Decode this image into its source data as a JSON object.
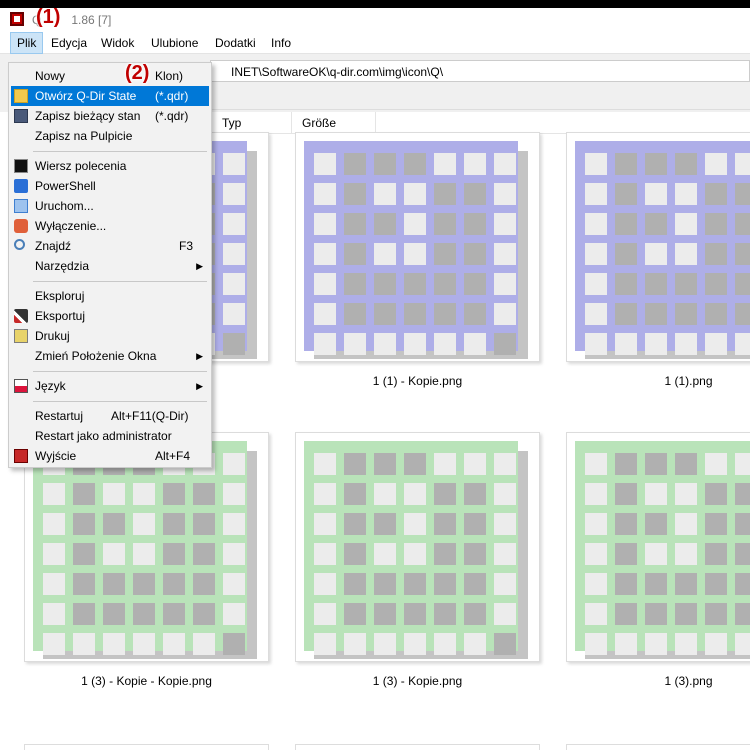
{
  "window": {
    "title_prefix": "Q",
    "title_rest": "1.86 [7]",
    "callout_1": "(1)",
    "callout_2": "(2)"
  },
  "menubar": {
    "items": [
      {
        "label": "Plik"
      },
      {
        "label": "Edycja"
      },
      {
        "label": "Widok"
      },
      {
        "label": "Ulubione"
      },
      {
        "label": "Dodatki"
      },
      {
        "label": "Info"
      }
    ]
  },
  "address": {
    "path": "INET\\SoftwareOK\\q-dir.com\\img\\icon\\Q\\"
  },
  "columns": {
    "typ": "Typ",
    "grosse": "Größe"
  },
  "file_menu": {
    "items": [
      {
        "label": "Nowy",
        "shortcut": "Klon)",
        "icon": "none"
      },
      {
        "label": "Otwórz Q-Dir State",
        "shortcut": "(*.qdr)",
        "icon": "folder-icon"
      },
      {
        "label": "Zapisz bieżący stan",
        "shortcut": "(*.qdr)",
        "icon": "save-icon"
      },
      {
        "label": "Zapisz na Pulpicie",
        "shortcut": "",
        "icon": "none"
      },
      {
        "label": "Wiersz polecenia",
        "shortcut": "",
        "icon": "cmd-icon"
      },
      {
        "label": "PowerShell",
        "shortcut": "",
        "icon": "powershell-icon"
      },
      {
        "label": "Uruchom...",
        "shortcut": "",
        "icon": "run-icon"
      },
      {
        "label": "Wyłączenie...",
        "shortcut": "",
        "icon": "shutdown-icon"
      },
      {
        "label": "Znajdź",
        "shortcut": "F3",
        "icon": "search-icon"
      },
      {
        "label": "Narzędzia",
        "shortcut": "",
        "icon": "none"
      },
      {
        "label": "Eksploruj",
        "shortcut": "",
        "icon": "none"
      },
      {
        "label": "Eksportuj",
        "shortcut": "",
        "icon": "export-icon"
      },
      {
        "label": "Drukuj",
        "shortcut": "",
        "icon": "print-icon"
      },
      {
        "label": "Zmień Położenie Okna",
        "shortcut": "",
        "icon": "none"
      },
      {
        "label": "Język",
        "shortcut": "",
        "icon": "language-icon"
      },
      {
        "label": "Restartuj",
        "shortcut": "Alt+F11(Q-Dir)",
        "icon": "none"
      },
      {
        "label": "Restart jako administrator",
        "shortcut": "",
        "icon": "none"
      },
      {
        "label": "Wyjście",
        "shortcut": "Alt+F4",
        "icon": "exit-icon"
      }
    ]
  },
  "files": [
    {
      "name": "",
      "color": "#aeaee8"
    },
    {
      "name": "1 (1) - Kopie.png",
      "color": "#aeaee8"
    },
    {
      "name": "1 (1).png",
      "color": "#aeaee8"
    },
    {
      "name": "1 (3) - Kopie - Kopie.png",
      "color": "#b9e3b9"
    },
    {
      "name": "1 (3) - Kopie.png",
      "color": "#b9e3b9"
    },
    {
      "name": "1 (3).png",
      "color": "#b9e3b9"
    }
  ],
  "colors": {
    "highlight": "#0078d7",
    "callout": "#c00000",
    "cell_light": "#ececec",
    "cell_dark": "#b0b0b0",
    "bottom_row": "#efe6bb"
  }
}
